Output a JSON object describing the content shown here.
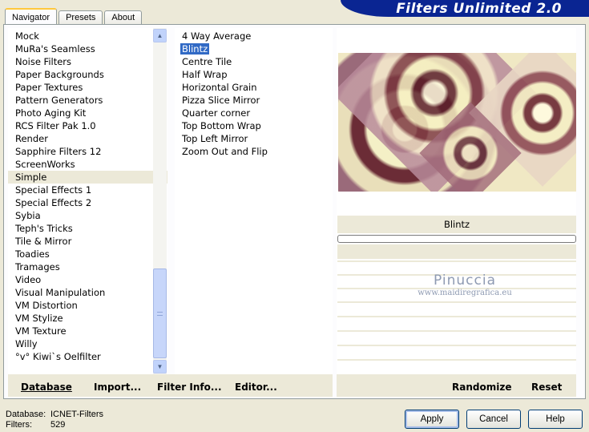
{
  "tabs": [
    {
      "label": "Navigator"
    },
    {
      "label": "Presets"
    },
    {
      "label": "About"
    }
  ],
  "title": "Filters Unlimited 2.0",
  "categories": [
    "Mock",
    "MuRa's Seamless",
    "Noise Filters",
    "Paper Backgrounds",
    "Paper Textures",
    "Pattern Generators",
    "Photo Aging Kit",
    "RCS Filter Pak 1.0",
    "Render",
    "Sapphire Filters 12",
    "ScreenWorks",
    "Simple",
    "Special Effects 1",
    "Special Effects 2",
    "Sybia",
    "Teph's Tricks",
    "Tile & Mirror",
    "Toadies",
    "Tramages",
    "Video",
    "Visual Manipulation",
    "VM Distortion",
    "VM Stylize",
    "VM Texture",
    "Willy",
    "°v° Kiwi`s Oelfilter"
  ],
  "selected_category": "Simple",
  "filters": [
    "4 Way Average",
    "Blintz",
    "Centre Tile",
    "Half Wrap",
    "Horizontal Grain",
    "Pizza Slice Mirror",
    "Quarter corner",
    "Top Bottom Wrap",
    "Top Left Mirror",
    "Zoom Out and Flip"
  ],
  "selected_filter": "Blintz",
  "filter_name_display": "Blintz",
  "watermark": {
    "line1": "Pinuccia",
    "line2": "www.maidiregrafica.eu"
  },
  "toolbar": {
    "database": "Database",
    "import": "Import...",
    "filter_info": "Filter Info...",
    "editor": "Editor...",
    "randomize": "Randomize",
    "reset": "Reset"
  },
  "status": {
    "database_label": "Database:",
    "database_value": "ICNET-Filters",
    "filters_label": "Filters:",
    "filters_value": "529"
  },
  "buttons": {
    "apply": "Apply",
    "cancel": "Cancel",
    "help": "Help"
  }
}
